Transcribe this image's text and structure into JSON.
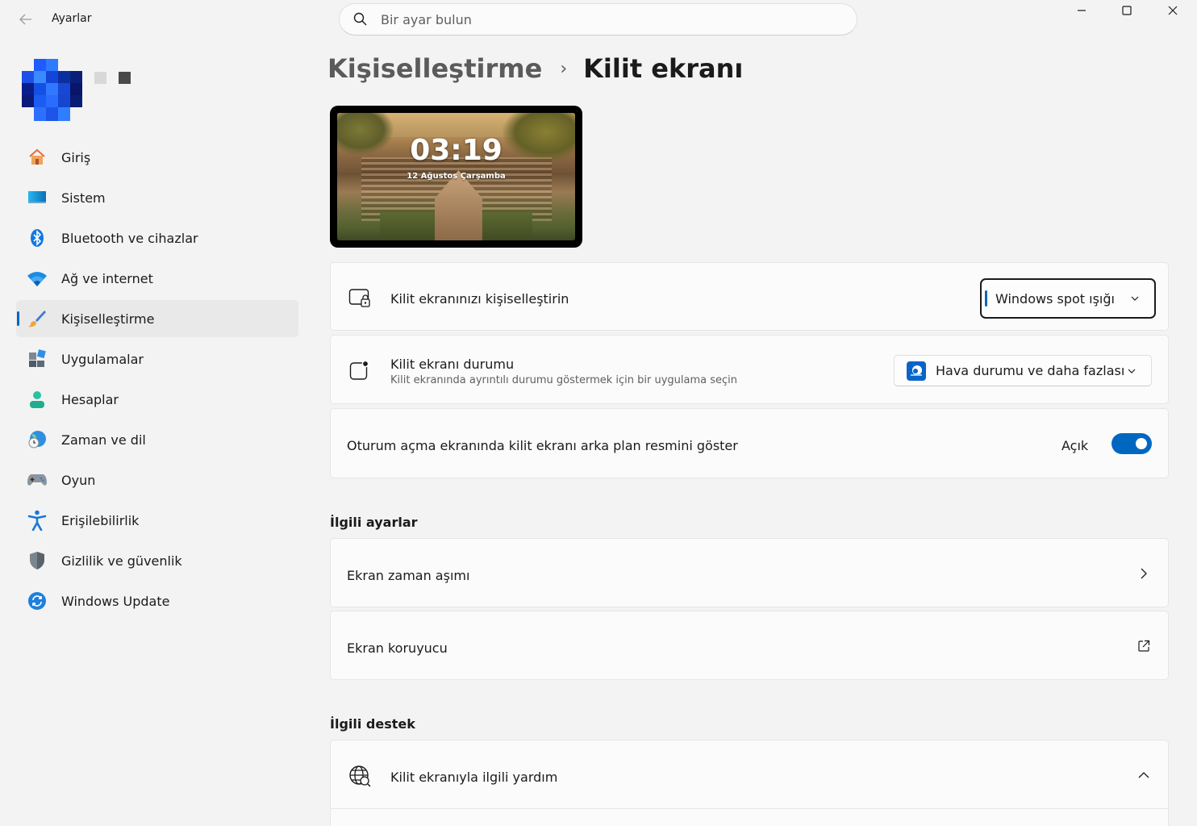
{
  "titlebar": {
    "app_title": "Ayarlar",
    "search_placeholder": "Bir ayar bulun"
  },
  "sidebar": {
    "items": [
      {
        "label": "Giriş",
        "icon": "home-icon"
      },
      {
        "label": "Sistem",
        "icon": "system-icon"
      },
      {
        "label": "Bluetooth ve cihazlar",
        "icon": "bluetooth-icon"
      },
      {
        "label": "Ağ ve internet",
        "icon": "wifi-icon"
      },
      {
        "label": "Kişiselleştirme",
        "icon": "brush-icon",
        "active": true
      },
      {
        "label": "Uygulamalar",
        "icon": "apps-icon"
      },
      {
        "label": "Hesaplar",
        "icon": "account-icon"
      },
      {
        "label": "Zaman ve dil",
        "icon": "globe-clock-icon"
      },
      {
        "label": "Oyun",
        "icon": "gamepad-icon"
      },
      {
        "label": "Erişilebilirlik",
        "icon": "accessibility-icon"
      },
      {
        "label": "Gizlilik ve güvenlik",
        "icon": "shield-icon"
      },
      {
        "label": "Windows Update",
        "icon": "update-icon"
      }
    ]
  },
  "breadcrumb": {
    "parent": "Kişiselleştirme",
    "separator": "›",
    "current": "Kilit ekranı"
  },
  "preview": {
    "time": "03:19",
    "date": "12 Ağustos Çarşamba"
  },
  "settings": {
    "personalize": {
      "label": "Kilit ekranınızı kişiselleştirin",
      "value": "Windows spot ışığı"
    },
    "status": {
      "label": "Kilit ekranı durumu",
      "sub": "Kilit ekranında ayrıntılı durumu göstermek için bir uygulama seçin",
      "value": "Hava durumu ve daha fazlası"
    },
    "signin_bg": {
      "label": "Oturum açma ekranında kilit ekranı arka plan resmini göster",
      "state": "Açık",
      "on": true
    }
  },
  "related": {
    "title": "İlgili ayarlar",
    "items": [
      {
        "label": "Ekran zaman aşımı",
        "icon": "chevron-right-icon"
      },
      {
        "label": "Ekran koruyucu",
        "icon": "external-link-icon"
      }
    ]
  },
  "support": {
    "title": "İlgili destek",
    "items": [
      {
        "label": "Kilit ekranıyla ilgili yardım",
        "icon": "globe-icon"
      }
    ]
  },
  "colors": {
    "accent": "#0067c0",
    "background": "#f3f3f3",
    "card": "#fbfbfb"
  }
}
